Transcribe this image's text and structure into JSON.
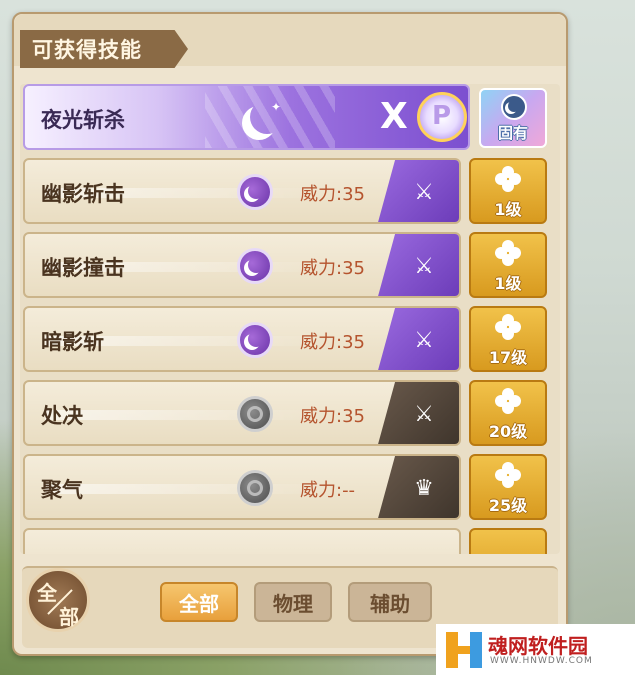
{
  "panel": {
    "title": "可获得技能"
  },
  "featured": {
    "name": "夜光斩杀",
    "xp_label": "X",
    "xp_p": "P",
    "innate_label": "固有"
  },
  "skills": [
    {
      "name": "幽影斩击",
      "power": "威力:35",
      "element": "purple-moon",
      "type_icon": "sword-icon",
      "level": "1级"
    },
    {
      "name": "幽影撞击",
      "power": "威力:35",
      "element": "purple-moon",
      "type_icon": "sword-icon",
      "level": "1级"
    },
    {
      "name": "暗影斩",
      "power": "威力:35",
      "element": "purple-moon",
      "type_icon": "sword-icon",
      "level": "17级"
    },
    {
      "name": "处决",
      "power": "威力:35",
      "element": "gray-ring",
      "type_icon": "sword-icon",
      "level": "20级"
    },
    {
      "name": "聚气",
      "power": "威力:--",
      "element": "gray-ring",
      "type_icon": "crown-icon",
      "level": "25级"
    }
  ],
  "filter": {
    "circle_top": "全",
    "circle_bottom": "部",
    "tabs": [
      "全部",
      "物理",
      "辅助"
    ],
    "active_tab": "全部"
  },
  "watermark": {
    "name": "魂网软件园",
    "url": "WWW.HNWDW.COM"
  },
  "colors": {
    "accent_purple": "#7c4fd0",
    "level_gold": "#e8a51f",
    "power_text": "#b5542e",
    "panel_bg": "#eee4cf"
  }
}
